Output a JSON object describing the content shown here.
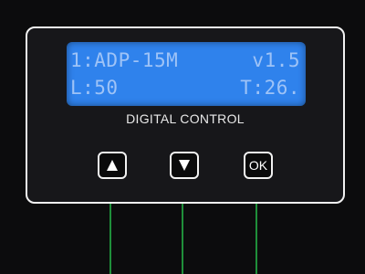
{
  "lcd": {
    "line1_left": "1:ADP-15M",
    "line1_right": "v1.5",
    "line2_left": "L:50",
    "line2_right": "T:26."
  },
  "panel": {
    "caption": "DIGITAL CONTROL"
  },
  "buttons": {
    "up_icon": "up-arrow-icon",
    "down_icon": "down-arrow-icon",
    "ok_label": "OK"
  },
  "colors": {
    "lcd_background": "#2f82ec",
    "lcd_text": "#9ec3f7",
    "wire": "#1f8f3a",
    "panel_border": "#f2f2f2"
  }
}
